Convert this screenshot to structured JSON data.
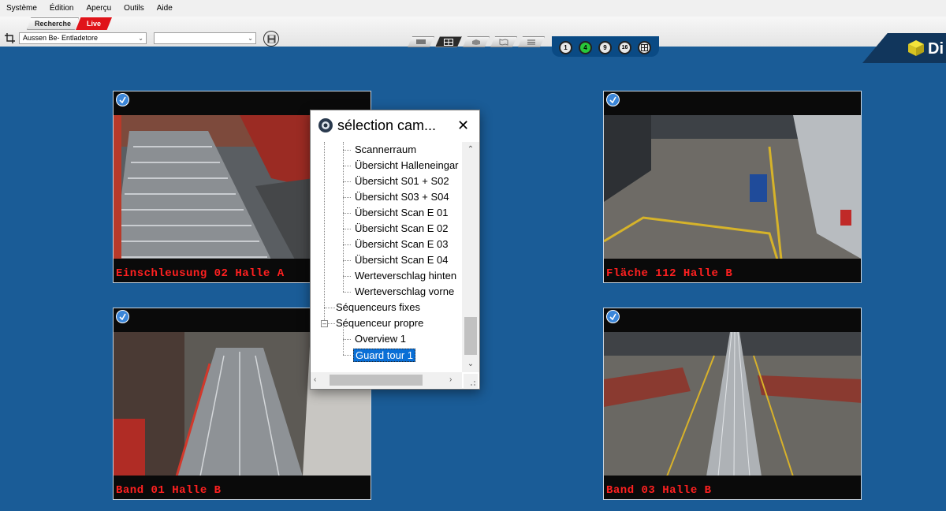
{
  "menu": [
    "Système",
    "Édition",
    "Aperçu",
    "Outils",
    "Aide"
  ],
  "toolbar": {
    "tab_recherche": "Recherche",
    "tab_live": "Live",
    "camera_select": "Aussen Be- Entladetore",
    "second_select": "",
    "logo_text": "Di"
  },
  "layout_buttons": [
    "1",
    "4",
    "9",
    "16"
  ],
  "active_layout": "4",
  "tiles": [
    {
      "caption": "Einschleusung 02 Halle A"
    },
    {
      "caption": "Fläche 112 Halle B"
    },
    {
      "caption": "Band 01 Halle B"
    },
    {
      "caption": "Band 03 Halle B"
    }
  ],
  "dialog": {
    "title": "sélection cam...",
    "close": "✕",
    "items": [
      "Scannerraum",
      "Übersicht Halleneingar",
      "Übersicht S01 + S02",
      "Übersicht S03 + S04",
      "Übersicht Scan E 01",
      "Übersicht Scan E 02",
      "Übersicht Scan E 03",
      "Übersicht Scan E 04",
      "Werteverschlag hinten",
      "Werteverschlag vorne"
    ],
    "group_fixed": "Séquenceurs fixes",
    "group_own": "Séquenceur propre",
    "own_items": [
      "Overview 1",
      "Guard tour 1"
    ]
  },
  "colors": {
    "background": "#1a5c97",
    "live_tab": "#e0141a",
    "caption": "#ff2020",
    "selected_item": "#0a6fd6",
    "active_layout": "#28c83a"
  }
}
